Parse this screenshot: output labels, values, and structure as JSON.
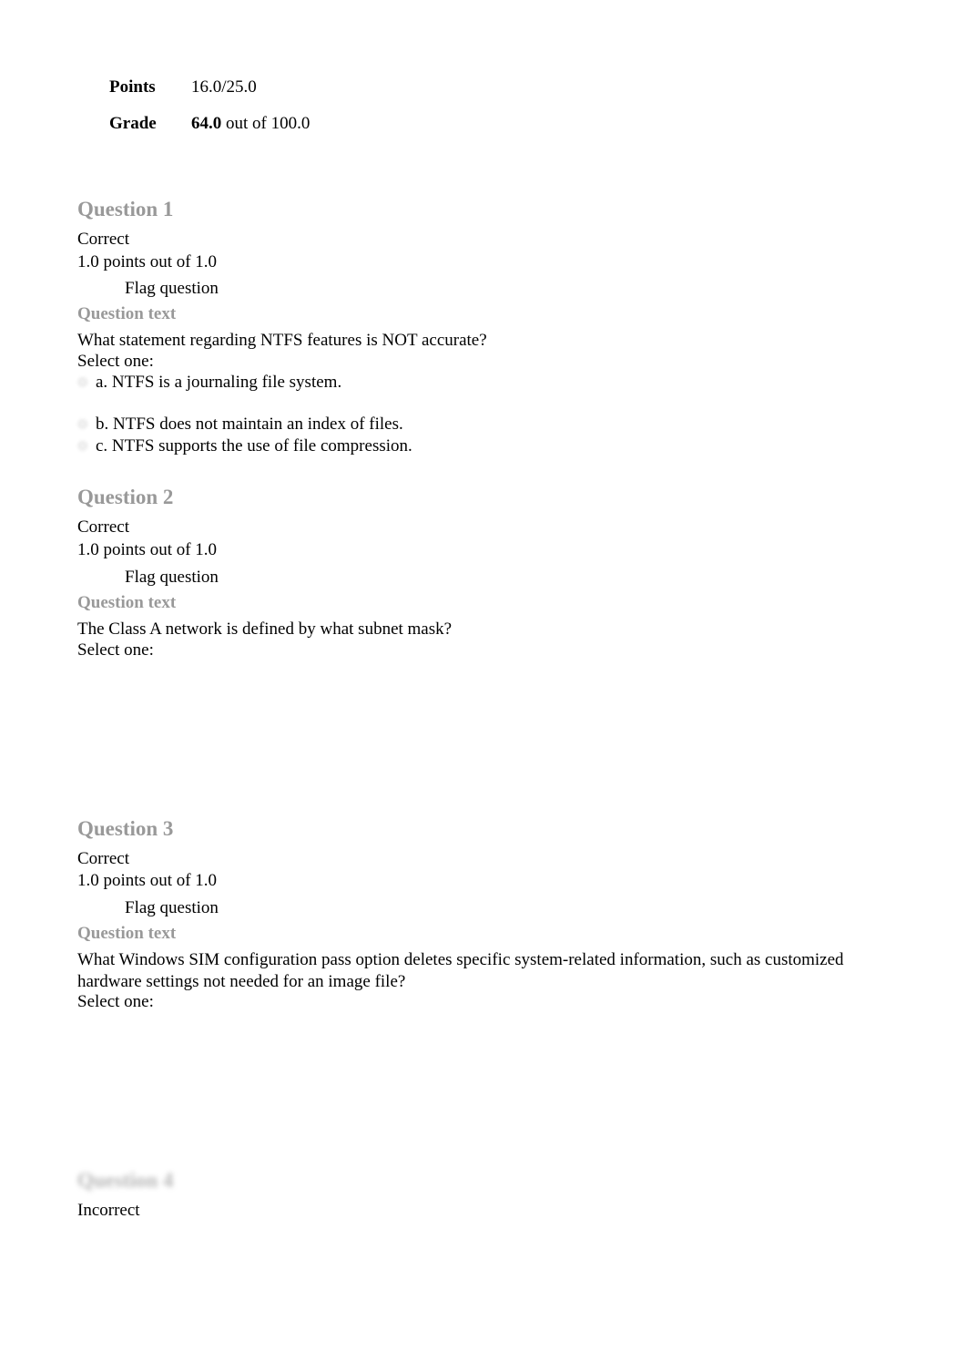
{
  "summary": {
    "points_label": "Points",
    "points_value": "16.0/25.0",
    "grade_label": "Grade",
    "grade_value_bold": "64.0",
    "grade_value_rest": " out of 100.0"
  },
  "questions": [
    {
      "heading": "Question 1",
      "status": "Correct",
      "points": "1.0 points out of 1.0",
      "flag": "Flag question",
      "text_heading": "Question text",
      "body": "What statement regarding NTFS features is NOT accurate?",
      "select_one": "Select one:",
      "options": [
        "a. NTFS is a journaling file system.",
        "b. NTFS does not maintain an index of files.",
        "c. NTFS supports the use of file compression."
      ]
    },
    {
      "heading": "Question 2",
      "status": "Correct",
      "points": "1.0 points out of 1.0",
      "flag": "Flag question",
      "text_heading": "Question text",
      "body": "The Class A network is defined by what subnet mask?",
      "select_one": "Select one:"
    },
    {
      "heading": "Question 3",
      "status": "Correct",
      "points": "1.0 points out of 1.0",
      "flag": "Flag question",
      "text_heading": "Question text",
      "body": "What Windows SIM configuration pass option deletes specific system-related information, such as customized hardware settings not needed for an image file?",
      "select_one": "Select one:"
    },
    {
      "heading": "Question 4",
      "status": "Incorrect"
    }
  ]
}
